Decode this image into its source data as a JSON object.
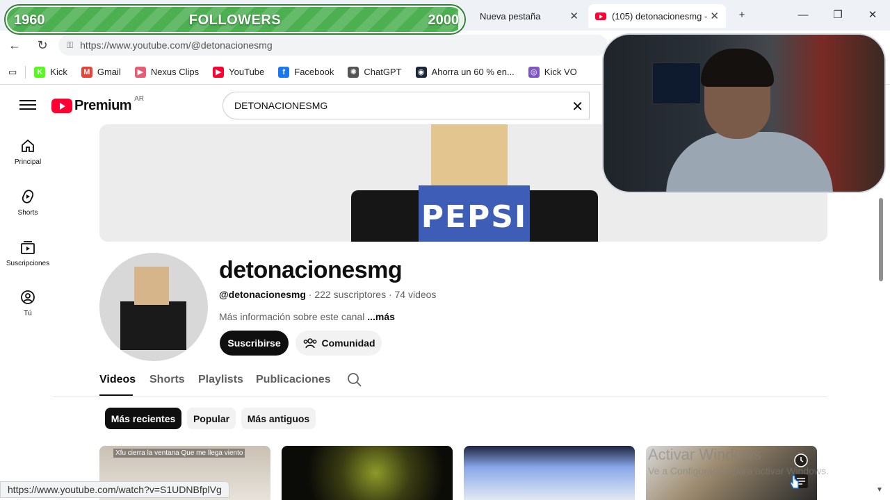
{
  "browser": {
    "tabs": [
      {
        "title": "Nueva pestaña",
        "active": false
      },
      {
        "title": "(105) detonacionesmg -",
        "active": true
      }
    ],
    "new_tab_symbol": "+",
    "url": "https://www.youtube.com/@detonacionesmg",
    "bookmarks": [
      {
        "label": "Kick",
        "icon": "kick-icon",
        "color": "#53fc18"
      },
      {
        "label": "Gmail",
        "icon": "gmail-icon",
        "color": "#ea4335"
      },
      {
        "label": "Nexus Clips",
        "icon": "nexus-clips-icon",
        "color": "#e85d75"
      },
      {
        "label": "YouTube",
        "icon": "youtube-icon",
        "color": "#ff0033"
      },
      {
        "label": "Facebook",
        "icon": "facebook-icon",
        "color": "#1877f2"
      },
      {
        "label": "ChatGPT",
        "icon": "chatgpt-icon",
        "color": "#555555"
      },
      {
        "label": "Ahorra un 60 % en...",
        "icon": "steam-icon",
        "color": "#1b2838"
      },
      {
        "label": "Kick VO",
        "icon": "kick-vo-icon",
        "color": "#7e57c2"
      }
    ],
    "status_url": "https://www.youtube.com/watch?v=S1UDNBfplVg"
  },
  "overlay": {
    "followers_label": "FOLLOWERS",
    "followers_min": "1960",
    "followers_max": "2000",
    "followers_fill": 0.99
  },
  "youtube": {
    "logo_text": "Premium",
    "region": "AR",
    "search_value": "DETONACIONESMG",
    "nav": [
      {
        "label": "Principal",
        "icon": "home-icon"
      },
      {
        "label": "Shorts",
        "icon": "shorts-icon"
      },
      {
        "label": "Suscripciones",
        "icon": "subscriptions-icon"
      },
      {
        "label": "Tú",
        "icon": "you-icon"
      }
    ],
    "banner_text": "PEPSI",
    "channel": {
      "name": "detonacionesmg",
      "handle": "@detonacionesmg",
      "meta_rest": " · 222 suscriptores · 74 videos",
      "desc": "Más información sobre este canal ",
      "desc_more": "...más",
      "subscribe": "Suscribirse",
      "community": "Comunidad"
    },
    "tabs": [
      "Videos",
      "Shorts",
      "Playlists",
      "Publicaciones"
    ],
    "chips": [
      "Más recientes",
      "Popular",
      "Más antiguos"
    ],
    "thumb_caption": "Xfu cierra la ventana Que me llega viento"
  },
  "watermark": {
    "line1": "Activar Windows",
    "line2": "Ve a Configuración para activar Windows."
  },
  "colors": {
    "accent": "#ff0033",
    "followers_bar": "#4caf50"
  }
}
